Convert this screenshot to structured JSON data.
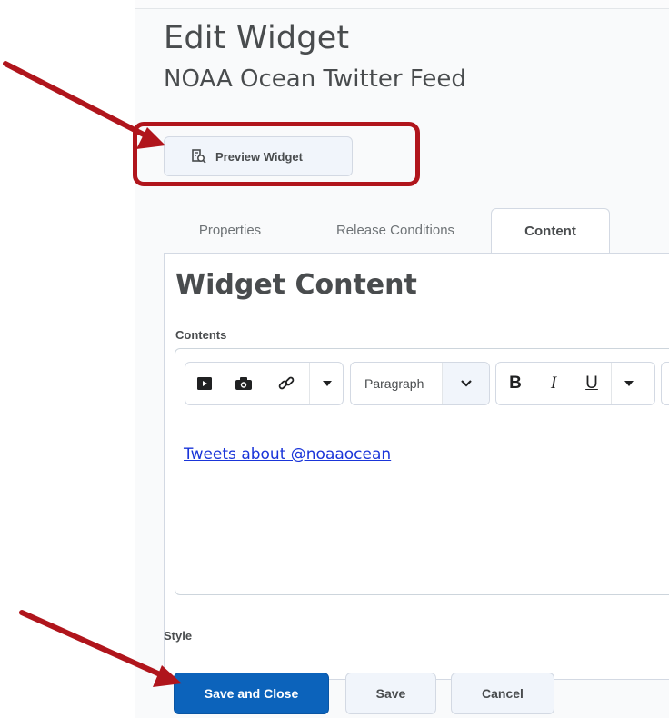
{
  "header": {
    "title": "Edit Widget",
    "subtitle": "NOAA Ocean Twitter Feed"
  },
  "preview": {
    "label": "Preview Widget",
    "icon": "preview-search-icon"
  },
  "tabs": [
    {
      "label": "Properties",
      "active": false
    },
    {
      "label": "Release Conditions",
      "active": false
    },
    {
      "label": "Content",
      "active": true
    }
  ],
  "panel": {
    "heading": "Widget Content",
    "contents_label": "Contents"
  },
  "toolbar": {
    "insert_icons": [
      "insert-video-icon",
      "insert-image-icon",
      "insert-link-icon",
      "more-dropdown-icon"
    ],
    "paragraph_label": "Paragraph",
    "bold": "B",
    "italic": "I",
    "underline": "U"
  },
  "editor": {
    "content_link": "Tweets about @noaaocean"
  },
  "style_label": "Style",
  "ghost_text": "ty",
  "actions": {
    "save_close": "Save and Close",
    "save": "Save",
    "cancel": "Cancel"
  },
  "colors": {
    "annotation": "#b0151c",
    "primary": "#0c63bb",
    "link": "#1a35d9"
  }
}
